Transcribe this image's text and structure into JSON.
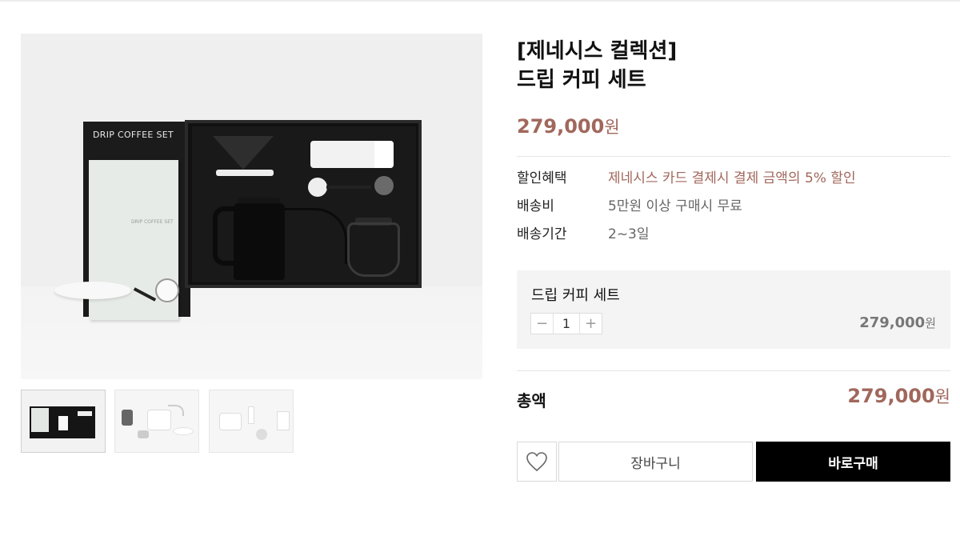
{
  "gallery": {
    "main_image_text": "DRIP COFFEE SET",
    "booklet_text": "DRIP COFFEE SET",
    "thumbnail_count": 3
  },
  "product": {
    "title_line1": "[제네시스 컬렉션]",
    "title_line2": "드립 커피 세트",
    "price_number": "279,000",
    "price_unit": "원"
  },
  "info": {
    "discount_label": "할인혜택",
    "discount_value": "제네시스 카드 결제시 결제 금액의 5% 할인",
    "shipping_label": "배송비",
    "shipping_value": "5만원 이상 구매시 무료",
    "delivery_label": "배송기간",
    "delivery_value": "2~3일"
  },
  "option": {
    "name": "드립 커피 세트",
    "minus": "−",
    "quantity": "1",
    "plus": "+",
    "price_number": "279,000",
    "price_unit": "원"
  },
  "total": {
    "label": "총액",
    "price_number": "279,000",
    "price_unit": "원"
  },
  "actions": {
    "wishlist_icon": "heart-icon",
    "cart_label": "장바구니",
    "buy_label": "바로구매"
  },
  "colors": {
    "accent": "#a1675c",
    "buy_button": "#000000",
    "option_bg": "#f4f4f4"
  }
}
